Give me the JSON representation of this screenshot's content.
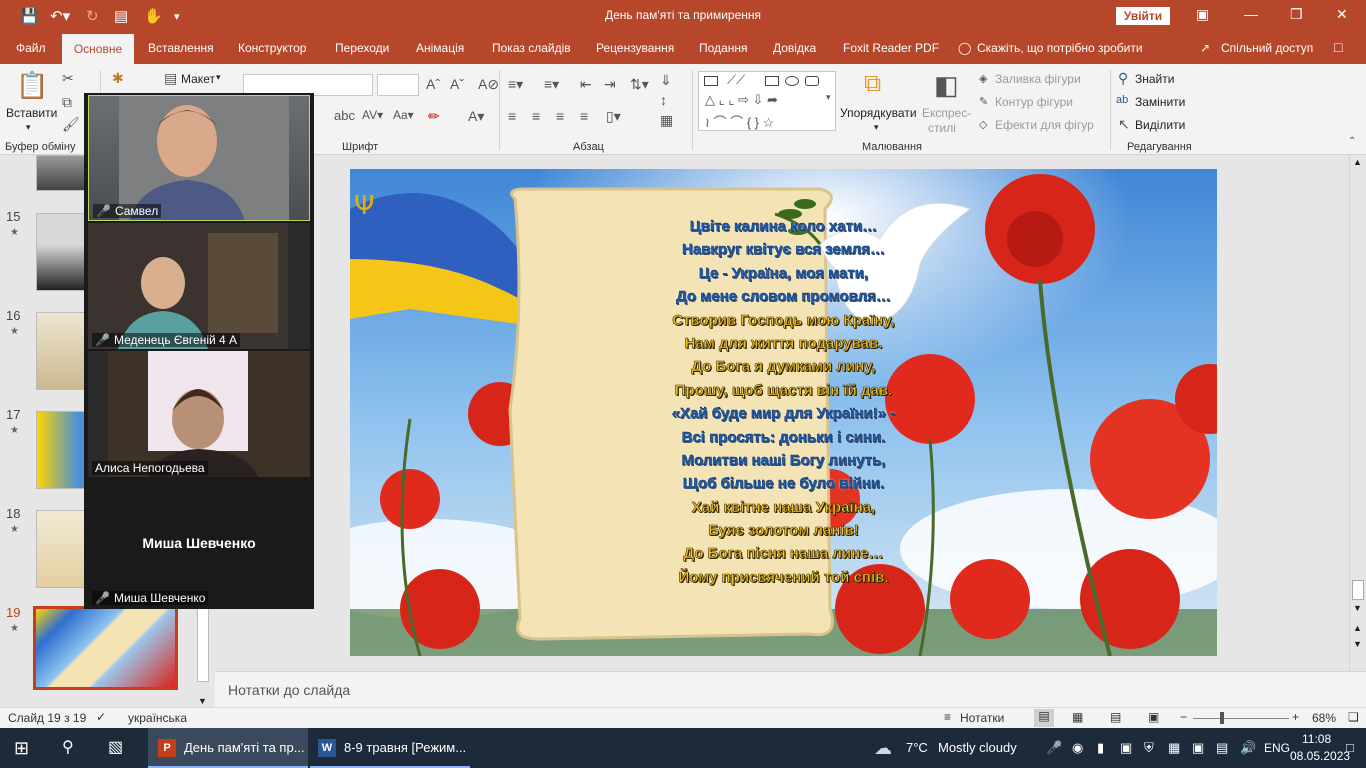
{
  "app": {
    "doc_title": "День пам'яті та примирення",
    "signin": "Увійти"
  },
  "tabs": [
    {
      "label": "Файл"
    },
    {
      "label": "Основне"
    },
    {
      "label": "Вставлення"
    },
    {
      "label": "Конструктор"
    },
    {
      "label": "Переходи"
    },
    {
      "label": "Анімація"
    },
    {
      "label": "Показ слайдів"
    },
    {
      "label": "Рецензування"
    },
    {
      "label": "Подання"
    },
    {
      "label": "Довідка"
    },
    {
      "label": "Foxit Reader PDF"
    }
  ],
  "tellme": "Скажіть, що потрібно зробити",
  "share": "Спільний доступ",
  "ribbon": {
    "paste": "Вставити",
    "layout": "Макет",
    "clipboard_group": "Буфер обміну",
    "font_group": "Шрифт",
    "paragraph_group": "Абзац",
    "drawing_group": "Малювання",
    "editing_group": "Редагування",
    "arrange": "Упорядкувати",
    "quick_styles_1": "Експрес-",
    "quick_styles_2": "стилі",
    "shape_fill": "Заливка фігури",
    "shape_outline": "Контур фігури",
    "shape_effects": "Ефекти для фігур",
    "find": "Знайти",
    "replace": "Замінити",
    "select": "Виділити"
  },
  "slides_pane": {
    "items": [
      {
        "num": "15"
      },
      {
        "num": "16"
      },
      {
        "num": "17"
      },
      {
        "num": "18"
      },
      {
        "num": "19"
      }
    ]
  },
  "video": {
    "participants": [
      {
        "name": "Самвел"
      },
      {
        "name": "Меденець Євгеній 4 А"
      },
      {
        "name": "Алиса Непогодьева"
      },
      {
        "name": "Миша Шевченко"
      }
    ],
    "big_name": "Миша Шевченко"
  },
  "poem": {
    "lines": [
      "Цвіте калина коло хати…",
      "Навкруг квітує вся земля…",
      "Це - Україна, моя мати,",
      "До мене словом промовля…",
      "Створив Господь мою Країну,",
      "Нам для життя подарував.",
      "До Бога я думками лину,",
      "Прошу, щоб щастя він їй дав.",
      "«Хай буде мир для України!» -",
      "Всі просять: доньки і сини.",
      "Молитви наші Богу линуть,",
      "Щоб більше не було війни.",
      "Хай квітне наша Україна,",
      "Буяє золотом ланів!",
      "До Бога пісня наша лине…",
      "Йому присвячений той спів."
    ]
  },
  "notes": {
    "placeholder": "Нотатки до слайда"
  },
  "status": {
    "slide": "Слайд 19 з 19",
    "lang": "українська",
    "notes_btn": "Нотатки",
    "zoom": "68%"
  },
  "taskbar": {
    "ppt": "День пам'яті та пр...",
    "word": "8-9 травня [Режим...",
    "weather_temp": "7°C",
    "weather_desc": "Mostly cloudy",
    "lang": "ENG",
    "time": "11:08",
    "date": "08.05.2023"
  },
  "colors": {
    "accent": "#b7472a",
    "taskbar": "#1c2a3a"
  }
}
